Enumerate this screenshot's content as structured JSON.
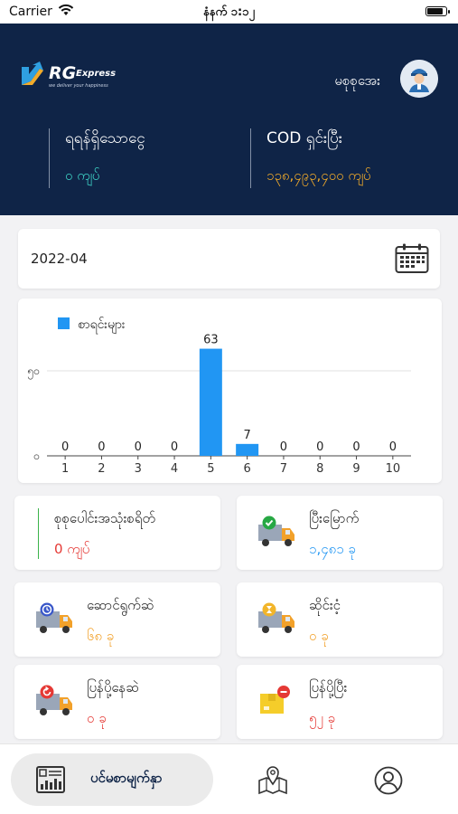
{
  "status_bar": {
    "carrier": "Carrier",
    "time": "နံနက် ၁:၁၂",
    "battery_level": 0.9
  },
  "header": {
    "logo": {
      "brand": "RG",
      "brand_suffix": "Express",
      "tagline": "we deliver your happiness"
    },
    "username": "မစုစုအေး",
    "stats": [
      {
        "label": "ရရန်ရှိသောငွေ",
        "value": "၀ ကျပ်"
      },
      {
        "label": "COD ရှင်းပြီး",
        "value": "၁၃၈,၄၉၃,၄၀၀ ကျပ်"
      }
    ]
  },
  "date_picker": {
    "value": "2022-04"
  },
  "chart_data": {
    "type": "bar",
    "legend": "စာရင်းများ",
    "categories": [
      "1",
      "2",
      "3",
      "4",
      "5",
      "6",
      "7",
      "8",
      "9",
      "10"
    ],
    "values": [
      0,
      0,
      0,
      0,
      63,
      7,
      0,
      0,
      0,
      0
    ],
    "data_labels": [
      "0",
      "0",
      "0",
      "0",
      "63",
      "7",
      "0",
      "0",
      "0",
      "0"
    ],
    "y_ticks": [
      {
        "value": 0,
        "label": "၀"
      },
      {
        "value": 50,
        "label": "၅၀"
      }
    ],
    "ylim": [
      0,
      50
    ],
    "bar_color": "#2196f3",
    "grid": true
  },
  "tiles": [
    {
      "label": "စုစုပေါင်းအသုံးစရိတ်",
      "value": "0 ကျပ်",
      "color": "#e53935",
      "icon": "expense-line"
    },
    {
      "label": "ပြီးမြောက်",
      "value": "၁,၄၈၁ ခု",
      "color": "#2196f3",
      "icon": "truck-completed-icon"
    },
    {
      "label": "ဆောင်ရွက်ဆဲ",
      "value": "၆၈ ခု",
      "color": "#f2a12a",
      "icon": "truck-in-progress-icon"
    },
    {
      "label": "ဆိုင်းငံ့",
      "value": "၀ ခု",
      "color": "#f2a12a",
      "icon": "truck-pending-icon"
    },
    {
      "label": "ပြန်ပို့နေဆဲ",
      "value": "၀ ခု",
      "color": "#e53935",
      "icon": "truck-returning-icon"
    },
    {
      "label": "ပြန်ပို့ပြီး",
      "value": "၅၂ ခု",
      "color": "#e53935",
      "icon": "package-returned-icon"
    }
  ],
  "bottom_nav": {
    "home_label": "ပင်မစာမျက်နှာ",
    "items": [
      "dashboard-icon",
      "map-icon",
      "profile-icon"
    ]
  }
}
